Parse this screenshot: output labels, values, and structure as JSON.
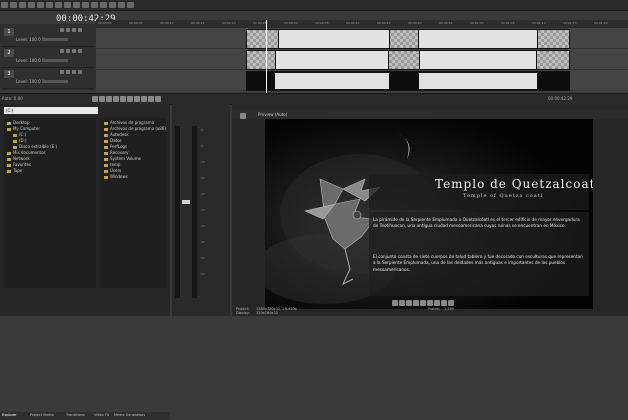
{
  "timeline": {
    "timecode": "00:00:42:29",
    "ruler_ticks": [
      "00:00:00",
      "00:00:05",
      "00:00:10",
      "00:00:15",
      "00:00:20",
      "00:00:25",
      "00:00:30",
      "00:00:35",
      "00:00:40",
      "00:00:45",
      "00:00:50",
      "00:00:55",
      "00:01:00",
      "00:01:05",
      "00:01:10",
      "00:01:15",
      "00:01:20"
    ],
    "tracks": [
      {
        "number": "1",
        "level_label": "Level: 100.0 %"
      },
      {
        "number": "2",
        "level_label": "Level: 100.0 %"
      },
      {
        "number": "3",
        "level_label": "Level: 100.0 %"
      }
    ],
    "rate_label": "Rate: 0.00",
    "end_time": "00:00:42:29"
  },
  "explorer": {
    "path": "(C:)",
    "tree": [
      "Desktop",
      "My Computer",
      "(C:)",
      "(D:)",
      "Disco extraíble (E:)",
      "Mis documentos",
      "Network",
      "Favorites",
      "Tape"
    ],
    "files": [
      "Archivos de programa",
      "Archivos de programa (x86)",
      "Autodesk",
      "Datos",
      "PerfLogs",
      "Recovery",
      "System Volume",
      "temp",
      "Users",
      "Windows"
    ],
    "tabs": [
      "Explorer",
      "Project Media",
      "Transitions",
      "Video FX",
      "Media Generators"
    ]
  },
  "preview": {
    "quality": "Preview (Auto)",
    "title": "Templo de Quetzalcoatl",
    "subtitle": "Temple of Quetza coatl",
    "paragraph1": "La pirámide de la Serpiente Emplumada o Quetzalcóatl es el tercer edificio de mayor envergadura de Teotihuacan, una antigua ciudad mesoamericana cuyas ruinas se encuentran en México.",
    "paragraph2": "El conjunto consta de siete cuerpos de talud tablero y fue decorado con esculturas que representan a la Serpiente Emplumada, una de las deidades más antiguas e importantes de los pueblos mesoamericanos.",
    "project_label": "Project:",
    "project_value": "1280x720x32, 29.970p",
    "frame_label": "Frame:",
    "frame_value": "1,289",
    "display_label": "Display:",
    "display_value": "320x180x32"
  }
}
